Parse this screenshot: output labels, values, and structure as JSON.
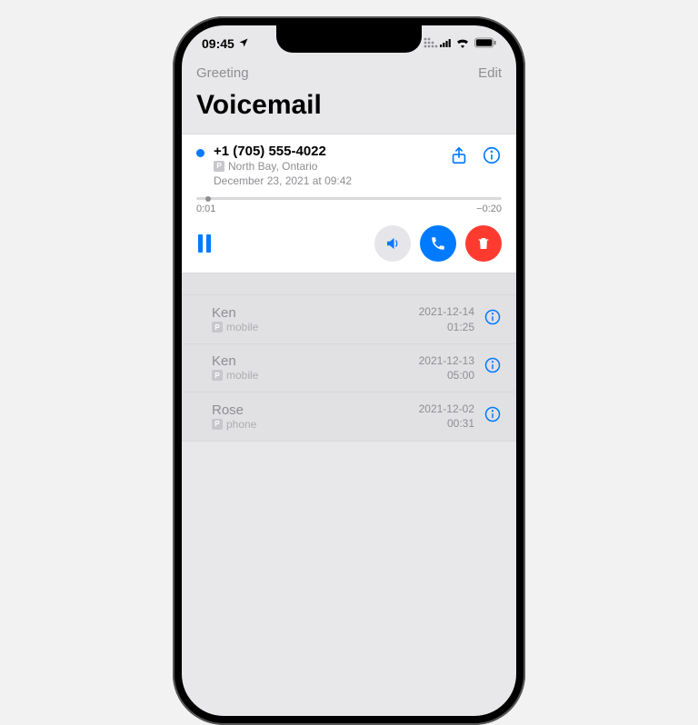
{
  "status": {
    "time": "09:45"
  },
  "header": {
    "greeting_label": "Greeting",
    "edit_label": "Edit",
    "title": "Voicemail"
  },
  "expanded": {
    "number": "+1 (705) 555-4022",
    "location": "North Bay, Ontario",
    "timestamp": "December 23, 2021 at 09:42",
    "elapsed": "0:01",
    "remaining": "−0:20"
  },
  "list": [
    {
      "name": "Ken",
      "type": "mobile",
      "date": "2021-12-14",
      "duration": "01:25"
    },
    {
      "name": "Ken",
      "type": "mobile",
      "date": "2021-12-13",
      "duration": "05:00"
    },
    {
      "name": "Rose",
      "type": "phone",
      "date": "2021-12-02",
      "duration": "00:31"
    }
  ],
  "colors": {
    "blue": "#007aff",
    "red": "#ff3b30",
    "grayText": "#8e8e93"
  }
}
